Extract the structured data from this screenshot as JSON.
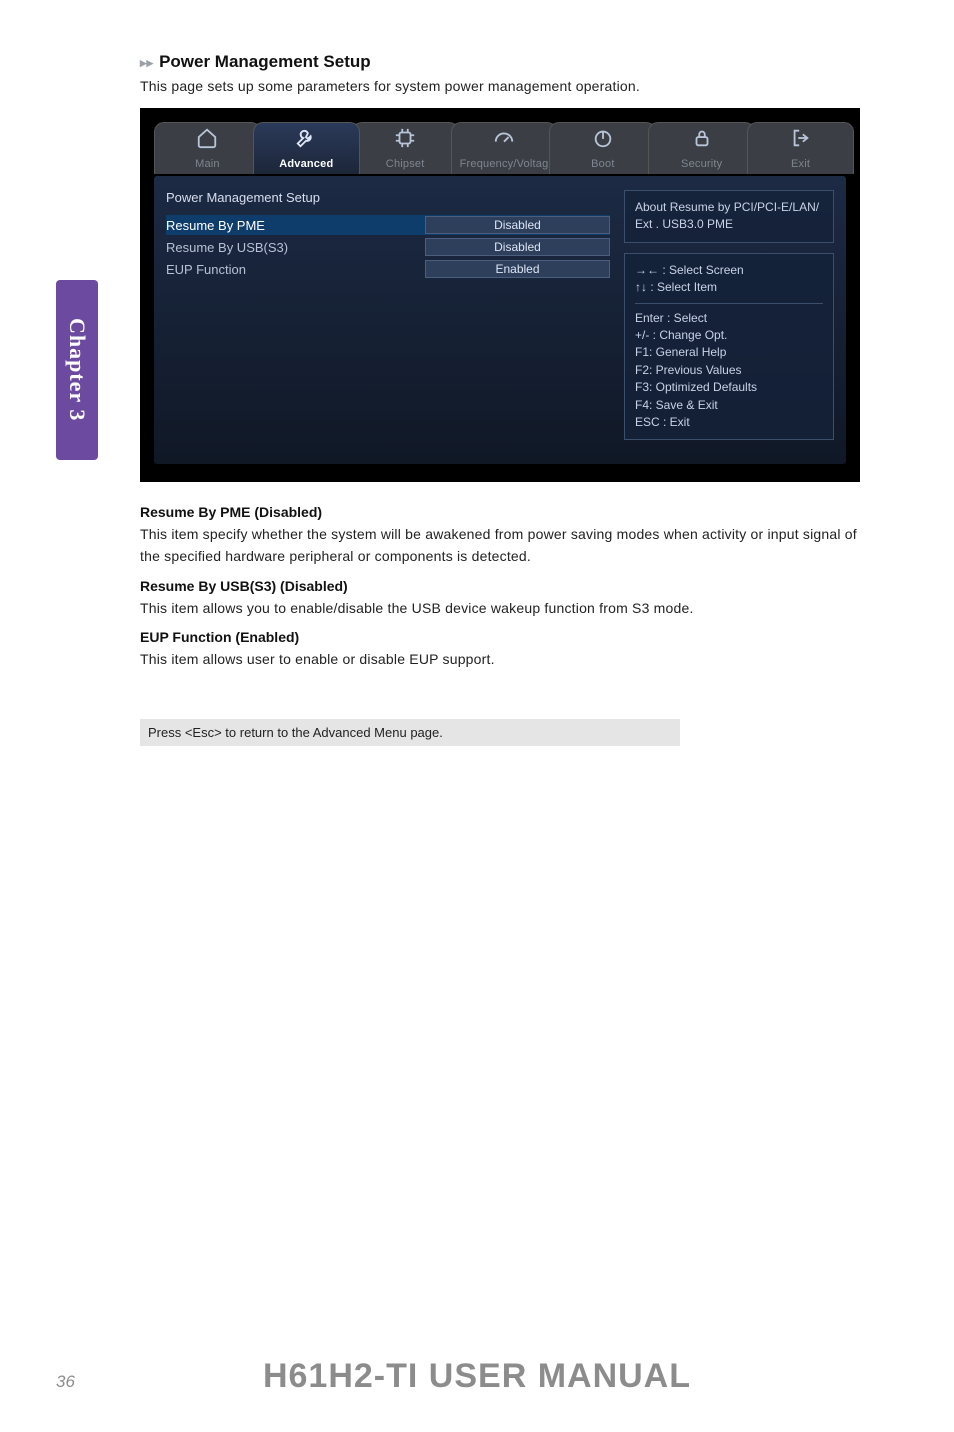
{
  "chapter_tab": "Chapter 3",
  "section": {
    "heading": "Power Management Setup",
    "lead": "This page sets up some parameters for system power management operation."
  },
  "bios": {
    "tabs": [
      {
        "label": "Main",
        "icon": "home-icon",
        "active": false
      },
      {
        "label": "Advanced",
        "icon": "wrench-icon",
        "active": true
      },
      {
        "label": "Chipset",
        "icon": "chip-icon",
        "active": false
      },
      {
        "label": "Frequency/Voltag",
        "icon": "gauge-icon",
        "active": false
      },
      {
        "label": "Boot",
        "icon": "power-icon",
        "active": false
      },
      {
        "label": "Security",
        "icon": "lock-icon",
        "active": false
      },
      {
        "label": "Exit",
        "icon": "exit-icon",
        "active": false
      }
    ],
    "group_title": "Power Management Setup",
    "settings": [
      {
        "label": "Resume By  PME",
        "value": "Disabled",
        "selected": true
      },
      {
        "label": "Resume By USB(S3)",
        "value": "Disabled",
        "selected": false
      },
      {
        "label": "EUP Function",
        "value": "Enabled",
        "selected": false
      }
    ],
    "about_box": "About  Resume by PCI/PCI-E/LAN/ Ext . USB3.0 PME",
    "help_box": {
      "line1": "→← : Select Screen",
      "line2": "↑↓ : Select Item",
      "line3": "Enter : Select",
      "line4": "+/- : Change Opt.",
      "line5": "F1: General Help",
      "line6": "F2: Previous Values",
      "line7": "F3: Optimized Defaults",
      "line8": "F4: Save & Exit",
      "line9": "ESC : Exit"
    }
  },
  "descriptions": [
    {
      "heading": "Resume By PME (Disabled)",
      "text": "This item specify whether the system will be awakened from power saving modes when activity or input signal of the specified hardware peripheral or components is detected."
    },
    {
      "heading": "Resume By USB(S3) (Disabled)",
      "text": "This item allows you to enable/disable the USB device wakeup function from S3 mode."
    },
    {
      "heading": "EUP Function (Enabled)",
      "text": "This item allows user to enable or disable EUP support."
    }
  ],
  "return_note": "Press <Esc> to return to the Advanced Menu page.",
  "footer_title": "H61H2-TI USER MANUAL",
  "page_number": "36"
}
